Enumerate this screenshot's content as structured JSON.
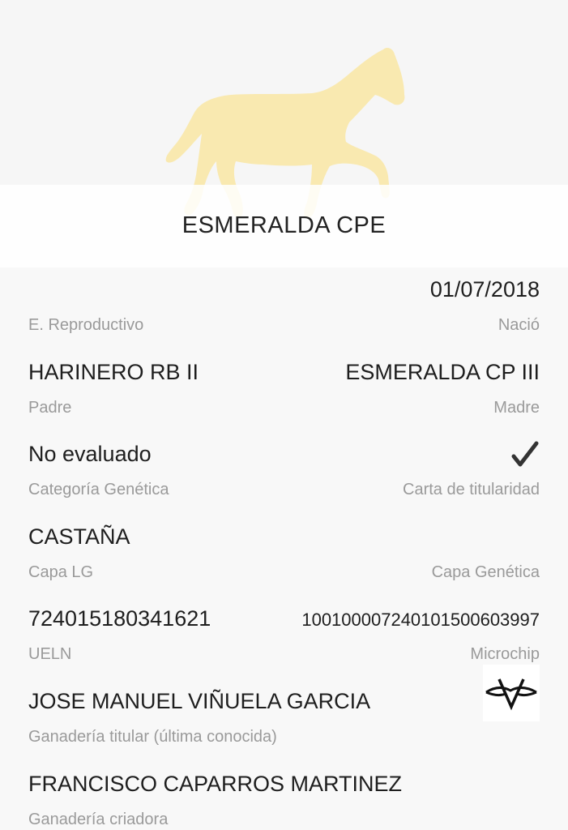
{
  "header": {
    "horse_name": "ESMERALDA CPE",
    "horse_color": "#f9e9b0"
  },
  "fields": {
    "birth_date": "01/07/2018",
    "e_reproductivo_label": "E. Reproductivo",
    "nacio_label": "Nació",
    "father": "HARINERO RB II",
    "father_label": "Padre",
    "mother": "ESMERALDA CP III",
    "mother_label": "Madre",
    "genetic_category": "No evaluado",
    "genetic_category_label": "Categoría Genética",
    "title_card_label": "Carta de titularidad",
    "title_card_checked": true,
    "capa_lg": "CASTAÑA",
    "capa_lg_label": "Capa LG",
    "capa_genetica_label": "Capa Genética",
    "ueln": "724015180341621",
    "ueln_label": "UELN",
    "microchip": "100100007240101500603997",
    "microchip_label": "Microchip",
    "owner_ranch": "JOSE MANUEL VIÑUELA GARCIA",
    "owner_ranch_label": "Ganadería titular (última conocida)",
    "owner_logo": "brand-mark-icon",
    "breeder_ranch": "FRANCISCO CAPARROS MARTINEZ",
    "breeder_ranch_label": "Ganadería criadora"
  }
}
